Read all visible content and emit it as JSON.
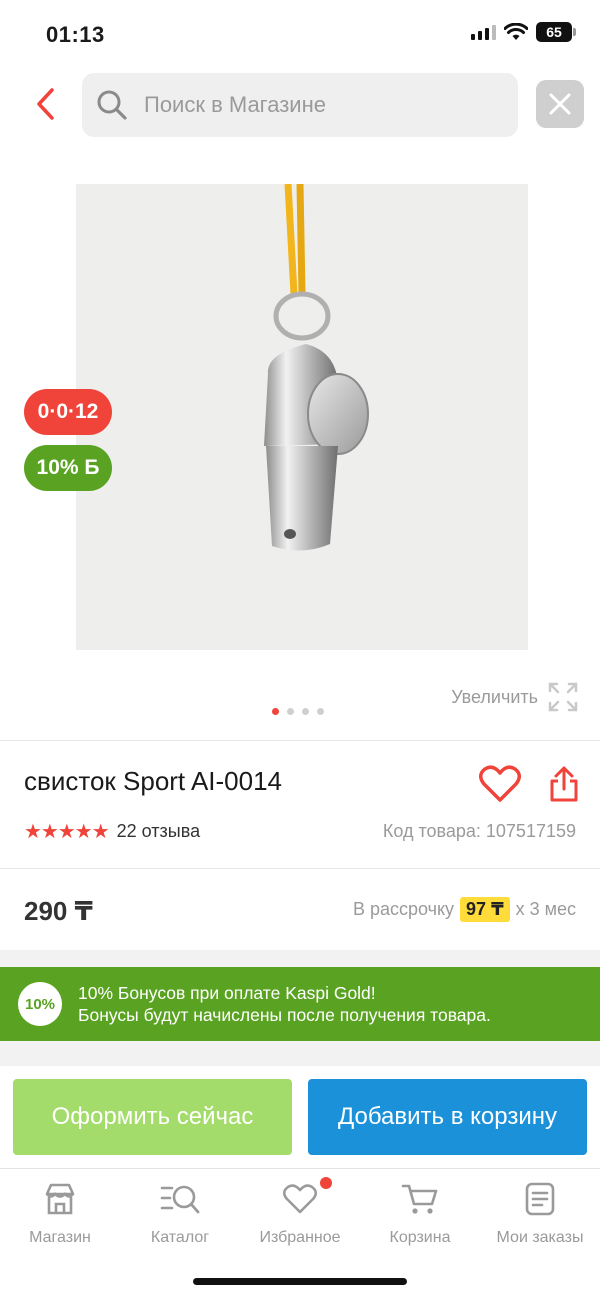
{
  "status_bar": {
    "time": "01:13",
    "battery": "65"
  },
  "search": {
    "placeholder": "Поиск в Магазине"
  },
  "gallery": {
    "badge_installment": "0·0·12",
    "badge_bonus": "10% Б",
    "zoom_label": "Увеличить",
    "dots_count": 4,
    "active_dot": 1
  },
  "product": {
    "title": "свисток Sport AI-0014",
    "stars": "★★★★★",
    "reviews": "22 отзыва",
    "code": "Код товара: 107517159",
    "price": "290 ₸",
    "installment_prefix": "В рассрочку",
    "installment_amount": "97 ₸",
    "installment_suffix": "х 3 мес"
  },
  "bonus": {
    "circle": "10%",
    "line1": "10% Бонусов при оплате Kaspi Gold!",
    "line2": "Бонусы будут начислены после получения товара."
  },
  "actions": {
    "order_now": "Оформить сейчас",
    "add_to_cart": "Добавить в корзину"
  },
  "tabbar": {
    "items": [
      {
        "label": "Магазин",
        "icon": "store-icon"
      },
      {
        "label": "Каталог",
        "icon": "catalog-search-icon"
      },
      {
        "label": "Избранное",
        "icon": "heart-icon"
      },
      {
        "label": "Корзина",
        "icon": "cart-icon"
      },
      {
        "label": "Мои заказы",
        "icon": "orders-icon"
      }
    ]
  },
  "colors": {
    "accent_red": "#f0433a",
    "kaspi_green": "#5aa322",
    "order_button": "#a3dc6a",
    "cart_button": "#1a91d9",
    "installment_highlight": "#ffdc3a"
  }
}
